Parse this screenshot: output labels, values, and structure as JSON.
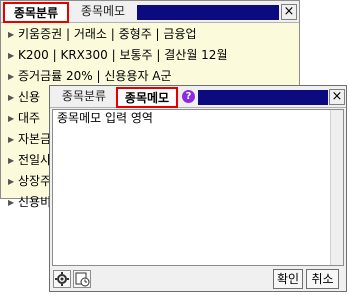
{
  "category_window": {
    "tab_active": "종목분류",
    "tab_inactive": "종목메모",
    "close_label": "×",
    "items": [
      {
        "label": "키움증권 | 거래소 | 중형주 | 금융업"
      },
      {
        "label": "K200 | KRX300 | 보통주 | 결산월 12월"
      },
      {
        "label": "증거금률 20% | 신용용자 A군"
      },
      {
        "label": "신용"
      },
      {
        "label": "대주"
      },
      {
        "label": "자본금"
      },
      {
        "label": "전일사"
      },
      {
        "label": "상장주"
      },
      {
        "label": "신용비"
      }
    ]
  },
  "memo_window": {
    "tab_inactive": "종목분류",
    "tab_active": "종목메모",
    "help_label": "?",
    "close_label": "×",
    "memo_placeholder": "종목메모 입력 영역",
    "confirm_label": "확인",
    "cancel_label": "취소"
  },
  "colors": {
    "accent_red": "#e60000",
    "title_navy": "#0b0b7f",
    "panel_yellow": "#fbfbdc",
    "help_purple": "#8a2be2"
  }
}
